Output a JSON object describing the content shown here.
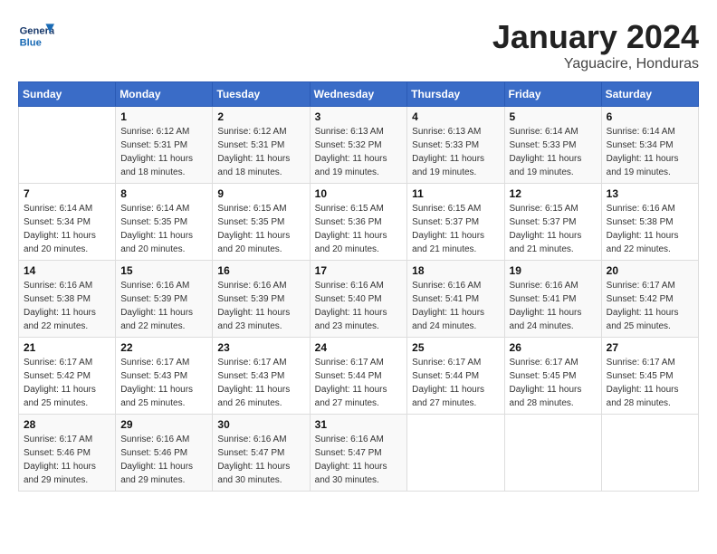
{
  "header": {
    "logo_general": "General",
    "logo_blue": "Blue",
    "month_year": "January 2024",
    "location": "Yaguacire, Honduras"
  },
  "weekdays": [
    "Sunday",
    "Monday",
    "Tuesday",
    "Wednesday",
    "Thursday",
    "Friday",
    "Saturday"
  ],
  "weeks": [
    [
      {
        "day": "",
        "sunrise": "",
        "sunset": "",
        "daylight": ""
      },
      {
        "day": "1",
        "sunrise": "Sunrise: 6:12 AM",
        "sunset": "Sunset: 5:31 PM",
        "daylight": "Daylight: 11 hours and 18 minutes."
      },
      {
        "day": "2",
        "sunrise": "Sunrise: 6:12 AM",
        "sunset": "Sunset: 5:31 PM",
        "daylight": "Daylight: 11 hours and 18 minutes."
      },
      {
        "day": "3",
        "sunrise": "Sunrise: 6:13 AM",
        "sunset": "Sunset: 5:32 PM",
        "daylight": "Daylight: 11 hours and 19 minutes."
      },
      {
        "day": "4",
        "sunrise": "Sunrise: 6:13 AM",
        "sunset": "Sunset: 5:33 PM",
        "daylight": "Daylight: 11 hours and 19 minutes."
      },
      {
        "day": "5",
        "sunrise": "Sunrise: 6:14 AM",
        "sunset": "Sunset: 5:33 PM",
        "daylight": "Daylight: 11 hours and 19 minutes."
      },
      {
        "day": "6",
        "sunrise": "Sunrise: 6:14 AM",
        "sunset": "Sunset: 5:34 PM",
        "daylight": "Daylight: 11 hours and 19 minutes."
      }
    ],
    [
      {
        "day": "7",
        "sunrise": "Sunrise: 6:14 AM",
        "sunset": "Sunset: 5:34 PM",
        "daylight": "Daylight: 11 hours and 20 minutes."
      },
      {
        "day": "8",
        "sunrise": "Sunrise: 6:14 AM",
        "sunset": "Sunset: 5:35 PM",
        "daylight": "Daylight: 11 hours and 20 minutes."
      },
      {
        "day": "9",
        "sunrise": "Sunrise: 6:15 AM",
        "sunset": "Sunset: 5:35 PM",
        "daylight": "Daylight: 11 hours and 20 minutes."
      },
      {
        "day": "10",
        "sunrise": "Sunrise: 6:15 AM",
        "sunset": "Sunset: 5:36 PM",
        "daylight": "Daylight: 11 hours and 20 minutes."
      },
      {
        "day": "11",
        "sunrise": "Sunrise: 6:15 AM",
        "sunset": "Sunset: 5:37 PM",
        "daylight": "Daylight: 11 hours and 21 minutes."
      },
      {
        "day": "12",
        "sunrise": "Sunrise: 6:15 AM",
        "sunset": "Sunset: 5:37 PM",
        "daylight": "Daylight: 11 hours and 21 minutes."
      },
      {
        "day": "13",
        "sunrise": "Sunrise: 6:16 AM",
        "sunset": "Sunset: 5:38 PM",
        "daylight": "Daylight: 11 hours and 22 minutes."
      }
    ],
    [
      {
        "day": "14",
        "sunrise": "Sunrise: 6:16 AM",
        "sunset": "Sunset: 5:38 PM",
        "daylight": "Daylight: 11 hours and 22 minutes."
      },
      {
        "day": "15",
        "sunrise": "Sunrise: 6:16 AM",
        "sunset": "Sunset: 5:39 PM",
        "daylight": "Daylight: 11 hours and 22 minutes."
      },
      {
        "day": "16",
        "sunrise": "Sunrise: 6:16 AM",
        "sunset": "Sunset: 5:39 PM",
        "daylight": "Daylight: 11 hours and 23 minutes."
      },
      {
        "day": "17",
        "sunrise": "Sunrise: 6:16 AM",
        "sunset": "Sunset: 5:40 PM",
        "daylight": "Daylight: 11 hours and 23 minutes."
      },
      {
        "day": "18",
        "sunrise": "Sunrise: 6:16 AM",
        "sunset": "Sunset: 5:41 PM",
        "daylight": "Daylight: 11 hours and 24 minutes."
      },
      {
        "day": "19",
        "sunrise": "Sunrise: 6:16 AM",
        "sunset": "Sunset: 5:41 PM",
        "daylight": "Daylight: 11 hours and 24 minutes."
      },
      {
        "day": "20",
        "sunrise": "Sunrise: 6:17 AM",
        "sunset": "Sunset: 5:42 PM",
        "daylight": "Daylight: 11 hours and 25 minutes."
      }
    ],
    [
      {
        "day": "21",
        "sunrise": "Sunrise: 6:17 AM",
        "sunset": "Sunset: 5:42 PM",
        "daylight": "Daylight: 11 hours and 25 minutes."
      },
      {
        "day": "22",
        "sunrise": "Sunrise: 6:17 AM",
        "sunset": "Sunset: 5:43 PM",
        "daylight": "Daylight: 11 hours and 25 minutes."
      },
      {
        "day": "23",
        "sunrise": "Sunrise: 6:17 AM",
        "sunset": "Sunset: 5:43 PM",
        "daylight": "Daylight: 11 hours and 26 minutes."
      },
      {
        "day": "24",
        "sunrise": "Sunrise: 6:17 AM",
        "sunset": "Sunset: 5:44 PM",
        "daylight": "Daylight: 11 hours and 27 minutes."
      },
      {
        "day": "25",
        "sunrise": "Sunrise: 6:17 AM",
        "sunset": "Sunset: 5:44 PM",
        "daylight": "Daylight: 11 hours and 27 minutes."
      },
      {
        "day": "26",
        "sunrise": "Sunrise: 6:17 AM",
        "sunset": "Sunset: 5:45 PM",
        "daylight": "Daylight: 11 hours and 28 minutes."
      },
      {
        "day": "27",
        "sunrise": "Sunrise: 6:17 AM",
        "sunset": "Sunset: 5:45 PM",
        "daylight": "Daylight: 11 hours and 28 minutes."
      }
    ],
    [
      {
        "day": "28",
        "sunrise": "Sunrise: 6:17 AM",
        "sunset": "Sunset: 5:46 PM",
        "daylight": "Daylight: 11 hours and 29 minutes."
      },
      {
        "day": "29",
        "sunrise": "Sunrise: 6:16 AM",
        "sunset": "Sunset: 5:46 PM",
        "daylight": "Daylight: 11 hours and 29 minutes."
      },
      {
        "day": "30",
        "sunrise": "Sunrise: 6:16 AM",
        "sunset": "Sunset: 5:47 PM",
        "daylight": "Daylight: 11 hours and 30 minutes."
      },
      {
        "day": "31",
        "sunrise": "Sunrise: 6:16 AM",
        "sunset": "Sunset: 5:47 PM",
        "daylight": "Daylight: 11 hours and 30 minutes."
      },
      {
        "day": "",
        "sunrise": "",
        "sunset": "",
        "daylight": ""
      },
      {
        "day": "",
        "sunrise": "",
        "sunset": "",
        "daylight": ""
      },
      {
        "day": "",
        "sunrise": "",
        "sunset": "",
        "daylight": ""
      }
    ]
  ]
}
